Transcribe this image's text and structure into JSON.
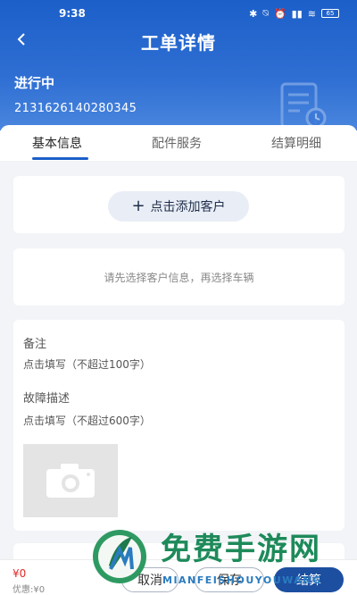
{
  "status_bar": {
    "time": "9:38",
    "battery": "65"
  },
  "header": {
    "title": "工单详情",
    "order_status": "进行中",
    "order_number": "2131626140280345"
  },
  "tabs": [
    {
      "label": "基本信息",
      "active": true
    },
    {
      "label": "配件服务",
      "active": false
    },
    {
      "label": "结算明细",
      "active": false
    }
  ],
  "customer": {
    "add_label": "点击添加客户"
  },
  "vehicle": {
    "hint": "请先选择客户信息，再选择车辆"
  },
  "notes": {
    "remark_label": "备注",
    "remark_placeholder": "点击填写（不超过100字）",
    "fault_label": "故障描述",
    "fault_placeholder": "点击填写（不超过600字）"
  },
  "footer": {
    "total": "¥0",
    "discount": "优惠:¥0",
    "cancel_label": "取消",
    "save_label": "保存",
    "settle_label": "结算"
  },
  "watermark": {
    "title": "免费手游网",
    "subtitle": "MIANFEISHOUYOUWANG"
  },
  "colors": {
    "primary": "#1c5fc9",
    "button_primary": "#1c4fa0",
    "price": "#e02a2a"
  }
}
